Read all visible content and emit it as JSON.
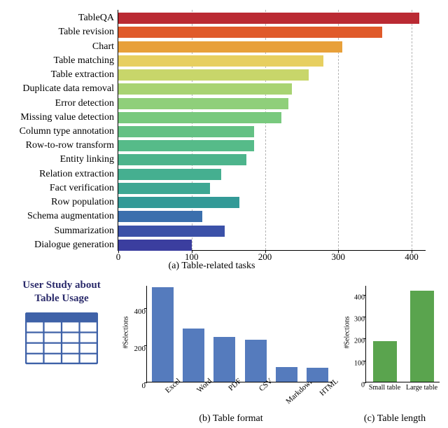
{
  "study": {
    "title_line1": "User Study about",
    "title_line2": "Table Usage"
  },
  "chart_data": [
    {
      "id": "a",
      "type": "bar",
      "orientation": "horizontal",
      "title": "(a) Table-related tasks",
      "xlabel": "",
      "ylabel": "",
      "xlim": [
        0,
        420
      ],
      "xticks": [
        0,
        100,
        200,
        300,
        400
      ],
      "categories": [
        "TableQA",
        "Table revision",
        "Chart",
        "Table matching",
        "Table extraction",
        "Duplicate data removal",
        "Error detection",
        "Missing value detection",
        "Column type annotation",
        "Row-to-row transform",
        "Entity linking",
        "Relation extraction",
        "Fact verification",
        "Row population",
        "Schema augmentation",
        "Summarization",
        "Dialogue generation"
      ],
      "values": [
        410,
        360,
        305,
        280,
        260,
        237,
        232,
        222,
        185,
        185,
        175,
        140,
        125,
        165,
        115,
        145,
        100
      ],
      "colors": [
        "#ba2a33",
        "#e05a2a",
        "#e8a03a",
        "#e7cf60",
        "#c8d66a",
        "#a8d373",
        "#8fcf7a",
        "#79c97e",
        "#64c184",
        "#56bb89",
        "#4db48c",
        "#45af90",
        "#3ea793",
        "#339a97",
        "#3b6fad",
        "#3b51a8",
        "#3b3e9f"
      ]
    },
    {
      "id": "b",
      "type": "bar",
      "orientation": "vertical",
      "title": "(b) Table format",
      "xlabel": "",
      "ylabel": "#Selections",
      "ylim": [
        0,
        520
      ],
      "yticks": [
        0,
        200,
        400
      ],
      "categories": [
        "Excel",
        "Word",
        "PDF",
        "CSV",
        "Markdown",
        "HTML"
      ],
      "values": [
        510,
        285,
        240,
        225,
        80,
        75
      ],
      "color": "#557bbd"
    },
    {
      "id": "c",
      "type": "bar",
      "orientation": "vertical",
      "title": "(c) Table length",
      "xlabel": "",
      "ylabel": "#Selections",
      "ylim": [
        0,
        440
      ],
      "yticks": [
        0,
        100,
        200,
        300,
        400
      ],
      "categories": [
        "Small table",
        "Large table"
      ],
      "values": [
        185,
        415
      ],
      "color": "#5aa44e"
    }
  ]
}
